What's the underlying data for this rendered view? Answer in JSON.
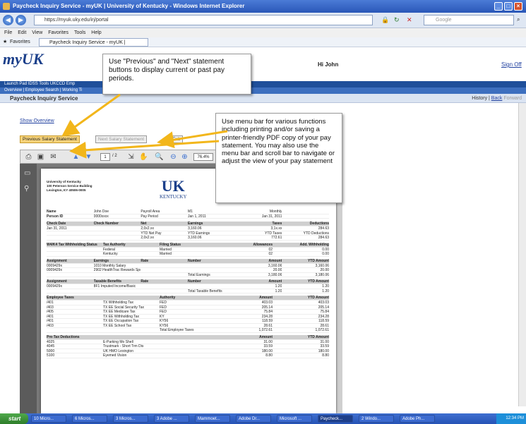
{
  "window": {
    "title": "Paycheck Inquiry Service - myUK | University of Kentucky - Windows Internet Explorer"
  },
  "browser": {
    "url": "https://myuk.uky.edu/irj/portal",
    "search_placeholder": "Google",
    "menu": [
      "File",
      "Edit",
      "View",
      "Favorites",
      "Tools",
      "Help"
    ],
    "favorites_label": "Favorites",
    "tab_label": "Paycheck Inquiry Service - myUK | University of Kentu..."
  },
  "portal": {
    "logo": "myUK",
    "greeting": "Hi John",
    "sign_off": "Sign Off",
    "nav_row1": "Launch Pad    IDSS Tools    UKCCD    Emp",
    "nav_row2": "Overview  |  Employee Search  |  Working Ti",
    "page_title": "Paycheck Inquiry Service",
    "history": "History",
    "back": "Back",
    "forward": "Forward"
  },
  "page": {
    "show_overview": "Show Overview",
    "prev_button": "Previous Salary Statement",
    "next_button": "Next Salary Statement",
    "exit_button": "Exit"
  },
  "pdf_toolbar": {
    "page_current": "1",
    "page_total": "/ 2",
    "zoom": "76.4%"
  },
  "statement": {
    "address": [
      "University of Kentucky",
      "100 Peterson Service Building",
      "Lexington, KY 40506-0005"
    ],
    "logo_big": "UK",
    "logo_small": "KENTUCKY",
    "info_rows": [
      [
        "Name",
        "John Doe",
        "Payroll Area",
        "M1",
        "Monthly",
        ""
      ],
      [
        "Person ID",
        "0000xxxx",
        "Pay Period",
        "Jan 1, 2011",
        "Jan 31, 2011",
        ""
      ]
    ],
    "check_header": [
      "Check Date",
      "Check Number",
      "Net",
      "Earnings",
      "Taxes",
      "Deductions"
    ],
    "check_rows": [
      [
        "Jan 31, 2011",
        "",
        "2,0x2.xx",
        "3,160.06",
        "3,1x.xx",
        "284.63"
      ],
      [
        "",
        "",
        "YTD Net Pay",
        "YTD Earnings",
        "YTD Taxes",
        "YTD Deductions"
      ],
      [
        "",
        "",
        "2,0x2.xx",
        "3,160.06",
        "772.61",
        "284.63"
      ]
    ],
    "w4_header": [
      "W4/K4 Tax Withholding Status",
      "Tax Authority",
      "Filing Status",
      "Allowances",
      "Add. Withholding"
    ],
    "w4_rows": [
      [
        "",
        "Federal",
        "Married",
        "02",
        "0.00"
      ],
      [
        "",
        "Kentucky",
        "Married",
        "02",
        "0.00"
      ]
    ],
    "earn_header": [
      "Assignment",
      "Earnings",
      "Rate",
      "Number",
      "Amount",
      "YTD Amount"
    ],
    "earn_rows": [
      [
        "0009429x",
        "1010 Monthly Salary",
        "",
        "",
        "3,160.06",
        "3,160.06"
      ],
      [
        "0009429x",
        "2902 HealthTrac Rewards Spo",
        "",
        "",
        "20.00",
        "20.00"
      ],
      [
        "",
        "",
        "",
        "Total Earnings",
        "3,180.06",
        "3,180.06"
      ]
    ],
    "taxable_header": [
      "Assignment",
      "Taxable Benefits",
      "Rate",
      "Number",
      "Amount",
      "YTD Amount"
    ],
    "taxable_rows": [
      [
        "0009429x",
        "8F1 Imputed Income/Basic",
        "",
        "",
        "1.20",
        "1.20"
      ],
      [
        "",
        "",
        "",
        "Total Taxable Benefits",
        "1.20",
        "1.20"
      ]
    ],
    "tax_header": [
      "Employee Taxes",
      "",
      "Authority",
      "Amount",
      "YTD Amount"
    ],
    "tax_rows": [
      [
        "/401",
        "TX Withholding Tax",
        "FED",
        "403.03",
        "403.03"
      ],
      [
        "/403",
        "TX EE Social Security Tax",
        "FED",
        "205.14",
        "205.14"
      ],
      [
        "/405",
        "TX EE Medicare Tax",
        "FED",
        "75.84",
        "75.84"
      ],
      [
        "/401",
        "TX EE Withholding Tax",
        "KY",
        "234.28",
        "234.28"
      ],
      [
        "/401",
        "TX EE Occupation Tax",
        "KY56",
        "118.59",
        "118.59"
      ],
      [
        "/403",
        "TX EE School Tax",
        "KY56",
        "28.61",
        "28.61"
      ],
      [
        "",
        "",
        "Total Employee Taxes",
        "1,072.61",
        "1,072.61"
      ]
    ],
    "pretax_header": [
      "Pre-Tax Deductions",
      "",
      "",
      "Amount",
      "YTD Amount"
    ],
    "pretax_rows": [
      [
        "4025",
        "E-Parking Mo Shell",
        "",
        "31.00",
        "31.00"
      ],
      [
        "4045",
        "Trustmark - Short Trm Dis",
        "",
        "33.59",
        "33.59"
      ],
      [
        "5000",
        "UK HMO Lexington",
        "",
        "180.00",
        "180.00"
      ],
      [
        "5100",
        "Eyemed Vision",
        "",
        "8.80",
        "8.80"
      ]
    ]
  },
  "callouts": {
    "c1": "Use \"Previous\" and \"Next\" statement buttons to display current or past pay periods.",
    "c2": "Use menu bar  for various functions including printing and/or saving a printer-friendly PDF copy of your pay statement. You may also use the menu bar and scroll bar to navigate or adjust the view of your pay statement"
  },
  "taskbar": {
    "start": "start",
    "tasks": [
      "10 Micro...",
      "6 Micros...",
      "3 Micros...",
      "3 Adobe ...",
      "Mammoet...",
      "Adobe Dr...",
      "Microsoft ...",
      "Paycheck...",
      "2 Windo...",
      "Adobe Ph..."
    ],
    "active_index": 7,
    "clock": "12:34 PM"
  },
  "colors": {
    "accent": "#1f4f9a",
    "callout_arrow": "#f2b61b",
    "prev_button": "#f7d37a"
  }
}
